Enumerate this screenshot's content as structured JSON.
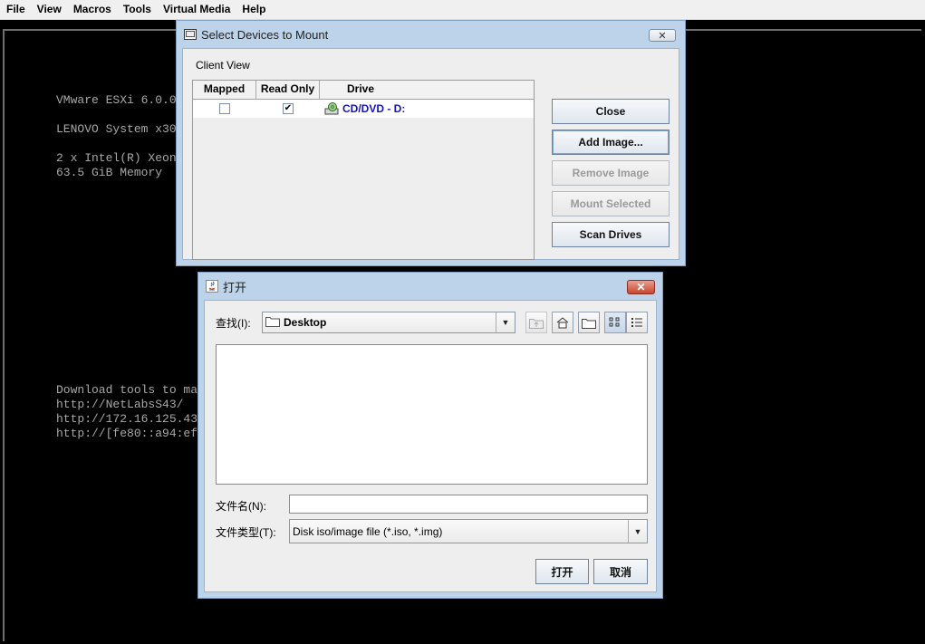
{
  "menubar": {
    "items": [
      "File",
      "View",
      "Macros",
      "Tools",
      "Virtual Media",
      "Help"
    ]
  },
  "console": {
    "lines_a": "VMware ESXi 6.0.0",
    "lines_b": "LENOVO System x30",
    "lines_c": "2 x Intel(R) Xeon\n63.5 GiB Memory",
    "lines_d": "Download tools to ma\nhttp://NetLabsS43/\nhttp://172.16.125.43\nhttp://[fe80::a94:ef"
  },
  "mount_dialog": {
    "title": "Select Devices to Mount",
    "client_view_label": "Client View",
    "columns": [
      "Mapped",
      "Read Only",
      "Drive"
    ],
    "rows": [
      {
        "mapped": false,
        "read_only": true,
        "drive": "CD/DVD - D:"
      }
    ],
    "buttons": {
      "close": "Close",
      "add_image": "Add Image...",
      "remove_image": "Remove Image",
      "mount_selected": "Mount Selected",
      "scan_drives": "Scan Drives"
    }
  },
  "open_dialog": {
    "title": "打开",
    "look_in_label": "查找(I):",
    "look_in_value": "Desktop",
    "filename_label": "文件名(N):",
    "filename_value": "",
    "filetype_label": "文件类型(T):",
    "filetype_value": "Disk iso/image file (*.iso, *.img)",
    "open_button": "打开",
    "cancel_button": "取消"
  },
  "colors": {
    "console_text": "#a8a8a8",
    "drive_link": "#1515b8",
    "window_frame": "#bcd3ea",
    "close_button_red": "#c8452e"
  }
}
